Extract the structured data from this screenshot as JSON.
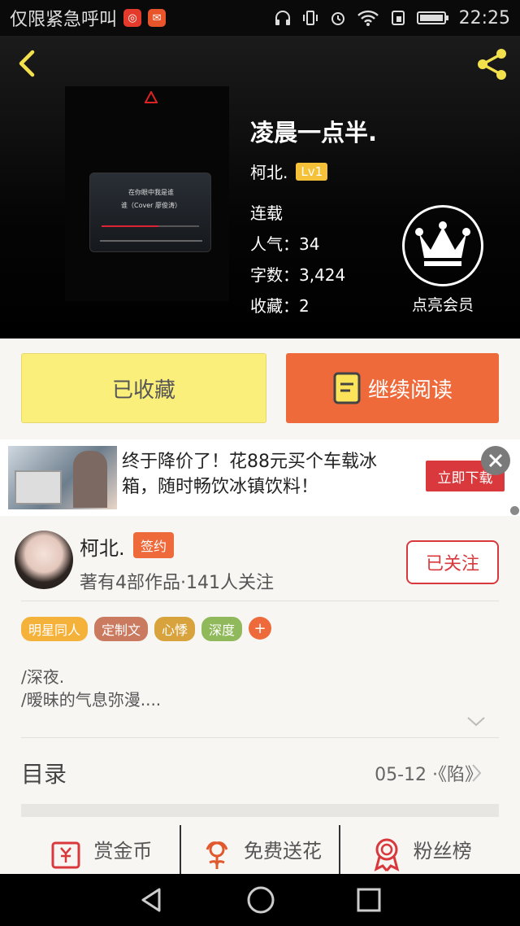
{
  "status_bar": {
    "carrier": "仅限紧急呼叫",
    "time": "22:25",
    "icons": [
      "netease-music-icon",
      "mail-icon",
      "headphones-icon",
      "vibrate-icon",
      "alarm-icon",
      "wifi-icon",
      "sim-icon",
      "battery-icon"
    ]
  },
  "book": {
    "title": "凌晨一点半.",
    "author": "柯北.",
    "level": "Lv1",
    "status": "连载",
    "popularity_label": "人气：",
    "popularity": "34",
    "words_label": "字数：",
    "words": "3,424",
    "favorites_label": "收藏：",
    "favorites": "2",
    "cover_text_line1": "在你眼中我是谁",
    "cover_text_line2": "谁（Cover 廖俊涛）"
  },
  "vip": {
    "label": "点亮会员"
  },
  "actions": {
    "collected": "已收藏",
    "continue_reading": "继续阅读"
  },
  "ad": {
    "text": "终于降价了！花88元买个车载冰箱，随时畅饮冰镇饮料！",
    "button": "立即下载"
  },
  "author_card": {
    "name": "柯北.",
    "badge": "签约",
    "subtitle": "著有4部作品·141人关注",
    "follow": "已关注",
    "tags": [
      {
        "label": "明星同人",
        "color": "#f5b23a"
      },
      {
        "label": "定制文",
        "color": "#c97a5f"
      },
      {
        "label": "心悸",
        "color": "#d8a33c"
      },
      {
        "label": "深度",
        "color": "#8fb95a"
      }
    ],
    "tag_more": "+",
    "desc_line1": "/深夜.",
    "desc_line2": "/暧昧的气息弥漫....",
    "toc_label": "目录",
    "toc_latest": "05-12 ·《陷》",
    "features": [
      {
        "label": "赏金币",
        "icon": "coin-icon"
      },
      {
        "label": "免费送花",
        "icon": "flower-icon"
      },
      {
        "label": "粉丝榜",
        "icon": "medal-icon"
      }
    ]
  },
  "colors": {
    "accent": "#ee6a3a",
    "collect_bg": "#fbef7c",
    "follow_red": "#d9393c",
    "level_badge": "#f5c138"
  }
}
